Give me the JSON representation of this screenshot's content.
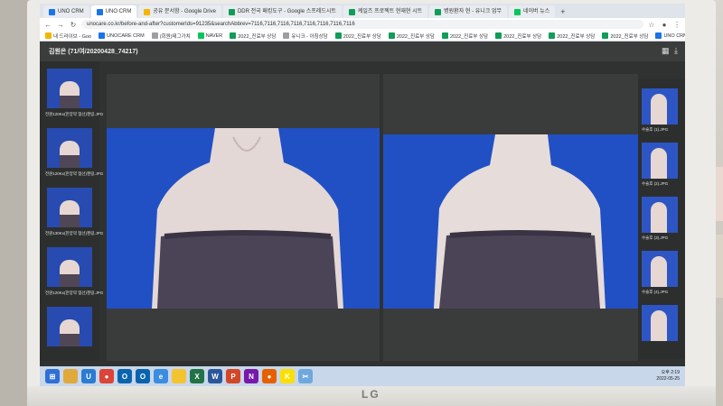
{
  "browser": {
    "tabs": [
      {
        "label": "UNO CRM",
        "color": "#1a73e8",
        "active": false
      },
      {
        "label": "UNO CRM",
        "color": "#1a73e8",
        "active": true
      },
      {
        "label": "공유 문서함 - Google Drive",
        "color": "#f4b400",
        "active": false
      },
      {
        "label": "DDR 전국 패킹도구 - Google 스프레드시트",
        "color": "#0f9d58",
        "active": false
      },
      {
        "label": "케일즈 프로젝트 현재현 시트",
        "color": "#0f9d58",
        "active": false
      },
      {
        "label": "병원환자 현 - 유니크 업무",
        "color": "#0f9d58",
        "active": false
      },
      {
        "label": "네이버 뉴스",
        "color": "#03c75a",
        "active": false
      }
    ],
    "new_tab_label": "+",
    "url": "unocare.co.kr/before-and-after?customerIds=91235&searchAbbrev=7116,7116,7116,7116,7116,7116,7116,7116"
  },
  "bookmarks": [
    {
      "label": "내 드라이브 - Goo",
      "color": "#f4b400"
    },
    {
      "label": "UNOCARE CRM",
      "color": "#1a73e8"
    },
    {
      "label": "(회원)태그가치",
      "color": "#9e9e9e"
    },
    {
      "label": "NAVER",
      "color": "#03c75a"
    },
    {
      "label": "2022_진료부 상담",
      "color": "#0f9d58"
    },
    {
      "label": "유니크 - 아침상담",
      "color": "#9e9e9e"
    },
    {
      "label": "2022_진료부 상담",
      "color": "#0f9d58"
    },
    {
      "label": "2022_진료부 상담",
      "color": "#0f9d58"
    },
    {
      "label": "2022_진료부 상담",
      "color": "#0f9d58"
    },
    {
      "label": "2022_진료부 상담",
      "color": "#0f9d58"
    },
    {
      "label": "2022_진료부 상담",
      "color": "#0f9d58"
    },
    {
      "label": "2022_진료부 상담",
      "color": "#0f9d58"
    },
    {
      "label": "UNO CRM",
      "color": "#1a73e8"
    }
  ],
  "app": {
    "patient_label": "김원은 (71/여/20200428_74217)",
    "grid_icon": "▦",
    "download_icon": "⤓"
  },
  "left_thumbnails": [
    {
      "caption": "전원120Kx(한양약 협선)젠링.JPG"
    },
    {
      "caption": "전원120Kx(한양약 협선)젠링.JPG"
    },
    {
      "caption": "전원130Kx(한양약 협선)젠링.JPG"
    },
    {
      "caption": "전원120Kx(한양약 협선)젠링.JPG"
    },
    {
      "caption": ""
    }
  ],
  "right_thumbnails": [
    {
      "caption": "수술후 (1).JPG"
    },
    {
      "caption": "수술후 (2).JPG"
    },
    {
      "caption": "수술후 (3).JPG"
    },
    {
      "caption": "수술후 (4).JPG"
    },
    {
      "caption": ""
    }
  ],
  "taskbar": {
    "apps": [
      {
        "name": "start-button",
        "color": "#2f6fd6",
        "glyph": "⊞"
      },
      {
        "name": "explorer-icon",
        "color": "#e0a93b",
        "glyph": ""
      },
      {
        "name": "uno-app-icon",
        "color": "#2b7cd3",
        "glyph": "U"
      },
      {
        "name": "chrome-icon",
        "color": "#db4437",
        "glyph": "●"
      },
      {
        "name": "outlook-icon",
        "color": "#0a64ad",
        "glyph": "O"
      },
      {
        "name": "outlook-icon-2",
        "color": "#0a64ad",
        "glyph": "O"
      },
      {
        "name": "ie-icon",
        "color": "#3b8de0",
        "glyph": "e"
      },
      {
        "name": "sticky-icon",
        "color": "#f4c430",
        "glyph": ""
      },
      {
        "name": "excel-icon",
        "color": "#217346",
        "glyph": "X"
      },
      {
        "name": "word-icon",
        "color": "#2b579a",
        "glyph": "W"
      },
      {
        "name": "powerpoint-icon",
        "color": "#d24726",
        "glyph": "P"
      },
      {
        "name": "onenote-icon",
        "color": "#7719aa",
        "glyph": "N"
      },
      {
        "name": "firefox-icon",
        "color": "#e66000",
        "glyph": "●"
      },
      {
        "name": "kakaotalk-icon",
        "color": "#f9e000",
        "glyph": "K"
      },
      {
        "name": "snipping-icon",
        "color": "#6fa8dc",
        "glyph": "✂"
      }
    ],
    "tray_time": "오후 2:19",
    "tray_date": "2022-05-25"
  },
  "monitor": {
    "brand": "LG"
  }
}
